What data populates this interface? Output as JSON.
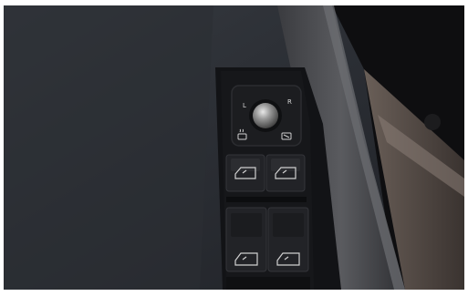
{
  "mirror_control": {
    "left_label": "L",
    "right_label": "R"
  },
  "window_switches": [
    {
      "icon": "window-icon"
    },
    {
      "icon": "window-icon"
    },
    {
      "icon": "window-icon"
    },
    {
      "icon": "window-icon"
    }
  ],
  "colors": {
    "door_panel": "#2a2d33",
    "armrest": "#4a4b4f",
    "switch_panel": "#16171a",
    "switch_button": "#222327",
    "icon": "#d0d0d0"
  }
}
